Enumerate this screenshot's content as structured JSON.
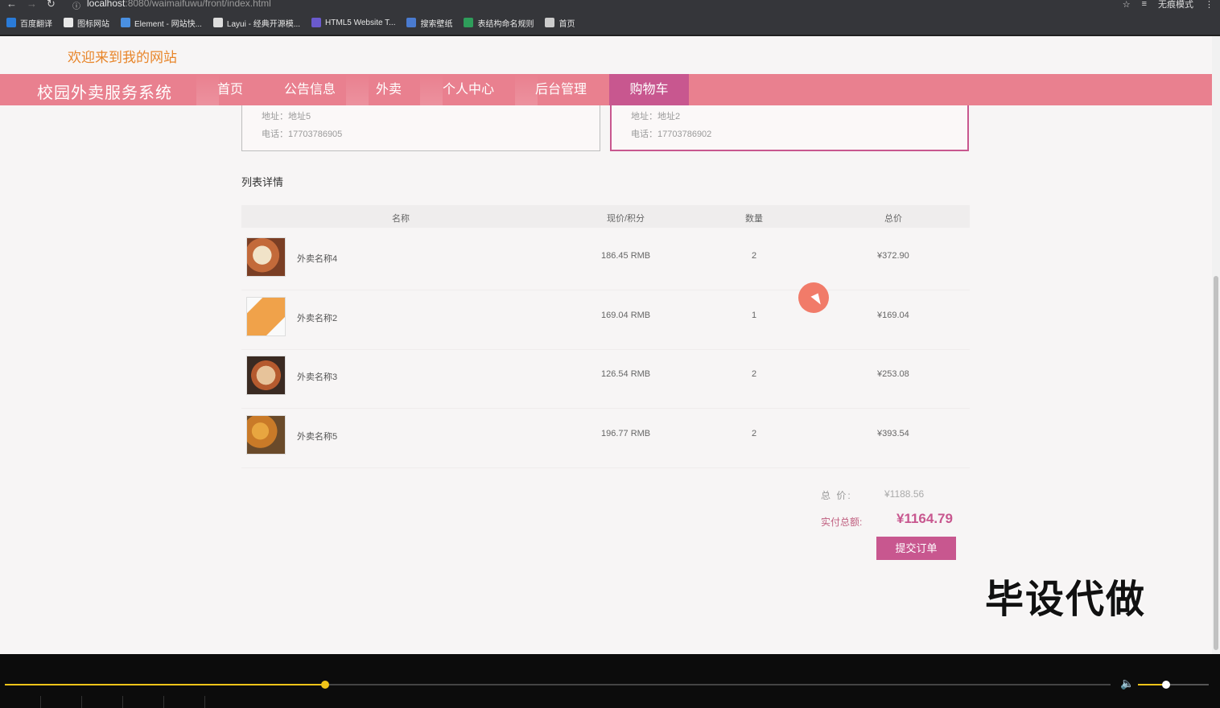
{
  "browser": {
    "url_host": "localhost",
    "url_path": ":8080/waimaifuwu/front/index.html",
    "incognito_label": "无痕模式",
    "bookmarks": [
      {
        "label": "百度翻译",
        "color": "#2a7bd8"
      },
      {
        "label": "图标网站",
        "color": "#e8e8e8"
      },
      {
        "label": "Element - 网站快...",
        "color": "#4a90e2"
      },
      {
        "label": "Layui - 经典开源模...",
        "color": "#dddddd"
      },
      {
        "label": "HTML5 Website T...",
        "color": "#6a5acd"
      },
      {
        "label": "搜索壁纸",
        "color": "#4a7bd0"
      },
      {
        "label": "表结构命名规则",
        "color": "#2e9d5a"
      },
      {
        "label": "首页",
        "color": "#cccccc"
      }
    ]
  },
  "header": {
    "welcome": "欢迎来到我的网站",
    "brand": "校园外卖服务系统",
    "nav": [
      "首页",
      "公告信息",
      "外卖",
      "个人中心",
      "后台管理",
      "购物车"
    ],
    "active_nav": "购物车"
  },
  "addresses": [
    {
      "address": "地址：地址5",
      "phone": "电话：17703786905"
    },
    {
      "address": "地址：地址2",
      "phone": "电话：17703786902"
    }
  ],
  "list": {
    "title": "列表详情",
    "columns": [
      "名称",
      "现价/积分",
      "数量",
      "总价"
    ],
    "rows": [
      {
        "name": "外卖名称4",
        "price": "186.45 RMB",
        "qty": "2",
        "total": "¥372.90"
      },
      {
        "name": "外卖名称2",
        "price": "169.04 RMB",
        "qty": "1",
        "total": "¥169.04"
      },
      {
        "name": "外卖名称3",
        "price": "126.54 RMB",
        "qty": "2",
        "total": "¥253.08"
      },
      {
        "name": "外卖名称5",
        "price": "196.77 RMB",
        "qty": "2",
        "total": "¥393.54"
      }
    ]
  },
  "summary": {
    "total_label": "总  价:",
    "total_value": "¥1188.56",
    "paid_label": "实付总额:",
    "paid_value": "¥1164.79",
    "submit_label": "提交订单"
  },
  "watermark": "毕设代做",
  "player": {
    "progress": 0.29,
    "volume": 0.4
  },
  "colors": {
    "accent": "#c8578f",
    "navbar": "#e9808f",
    "welcome": "#e8862b",
    "progress": "#f0c419"
  }
}
